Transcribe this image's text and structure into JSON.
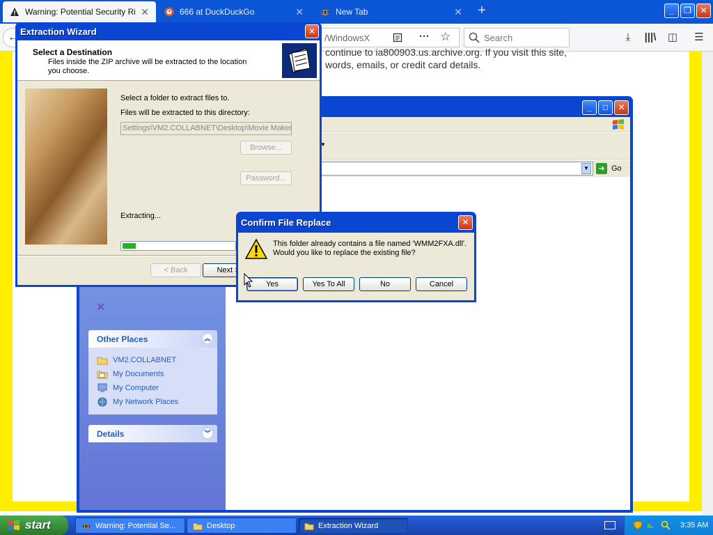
{
  "firefox": {
    "tabs": [
      {
        "label": "Warning: Potential Security Risk Ahead",
        "close": "✕"
      },
      {
        "label": "666 at DuckDuckGo",
        "close": "✕"
      },
      {
        "label": "New Tab",
        "close": "✕"
      }
    ],
    "new_tab": "+",
    "url_text": "/WindowsX",
    "search_placeholder": "Search",
    "page_text_line1": "continue to ia800903.us.archive.org. If you visit this site,",
    "page_text_line2": "words, emails, or credit card details."
  },
  "explorer": {
    "go_label": "Go",
    "other_places": {
      "title": "Other Places",
      "items": [
        "VM2.COLLABNET",
        "My Documents",
        "My Computer",
        "My Network Places"
      ]
    },
    "details_title": "Details"
  },
  "wizard": {
    "title": "Extraction Wizard",
    "heading": "Select a Destination",
    "subheading": "Files inside the ZIP archive will be extracted to the location you choose.",
    "select_label": "Select a folder to extract files to.",
    "dir_label": "Files will be extracted to this directory:",
    "dir_value": "Settings\\VM2.COLLABNET\\Desktop\\Movie Maker",
    "browse_label": "Browse...",
    "password_label": "Password...",
    "extracting_label": "Extracting...",
    "progress_fraction": 0.12,
    "back_label": "< Back",
    "next_label": "Next >"
  },
  "confirm": {
    "title": "Confirm File Replace",
    "message_line1": "This folder already contains a file named 'WMM2FXA.dll'.",
    "message_line2": "Would you like to replace the existing file?",
    "yes_label": "Yes",
    "yes_all_label": "Yes To All",
    "no_label": "No",
    "cancel_label": "Cancel"
  },
  "taskbar": {
    "start_label": "start",
    "tasks": [
      {
        "label": "Warning: Potential Se..."
      },
      {
        "label": "Desktop"
      },
      {
        "label": "Extraction Wizard"
      }
    ],
    "clock": "3:35 AM"
  }
}
